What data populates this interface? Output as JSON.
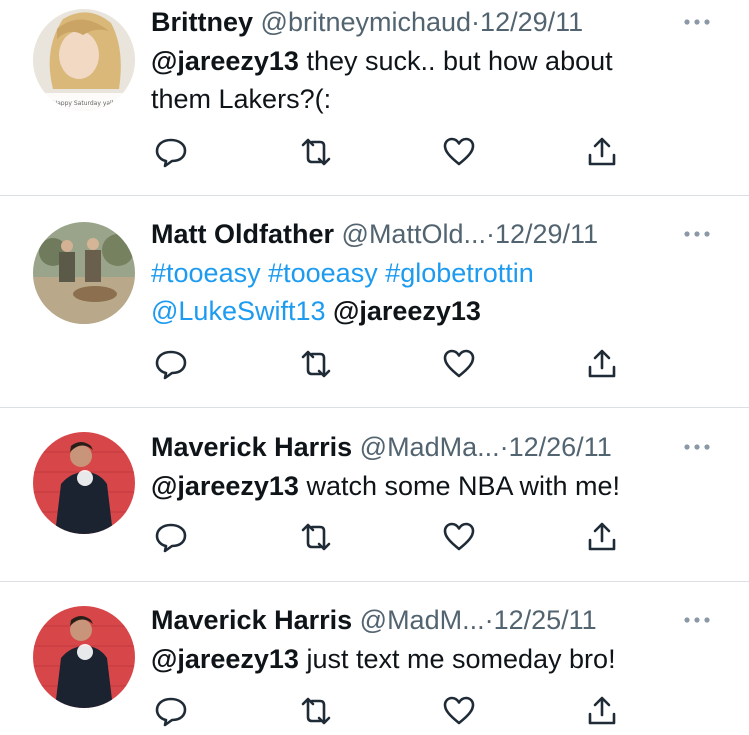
{
  "tweets": [
    {
      "name": "Brittney",
      "handle": "@britneymichaud",
      "sep": "·",
      "date": "12/29/11",
      "body": [
        {
          "type": "mention",
          "text": "@jareezy13"
        },
        {
          "type": "text",
          "text": " they suck.. but how about them Lakers?(:"
        }
      ],
      "avatar_caption": "Happy Saturday yall"
    },
    {
      "name": "Matt Oldfather",
      "handle": "@MattOld...",
      "sep": "·",
      "date": "12/29/11",
      "body": [
        {
          "type": "link",
          "text": "#tooeasy"
        },
        {
          "type": "text",
          "text": " "
        },
        {
          "type": "link",
          "text": "#tooeasy"
        },
        {
          "type": "text",
          "text": " "
        },
        {
          "type": "link",
          "text": "#globetrottin"
        },
        {
          "type": "text",
          "text": " "
        },
        {
          "type": "link",
          "text": "@LukeSwift13"
        },
        {
          "type": "text",
          "text": " "
        },
        {
          "type": "mention",
          "text": "@jareezy13"
        }
      ]
    },
    {
      "name": "Maverick Harris",
      "handle": "@MadMa...",
      "sep": "·",
      "date": "12/26/11",
      "body": [
        {
          "type": "mention",
          "text": "@jareezy13"
        },
        {
          "type": "text",
          "text": " watch some NBA with me!"
        }
      ]
    },
    {
      "name": "Maverick Harris",
      "handle": "@MadM...",
      "sep": "·",
      "date": "12/25/11",
      "body": [
        {
          "type": "mention",
          "text": "@jareezy13"
        },
        {
          "type": "text",
          "text": " just text me someday bro!"
        }
      ]
    }
  ],
  "colors": {
    "text": "#0f1419",
    "secondary": "#536471",
    "link": "#1d9bf0",
    "divider": "#dcdfe3"
  },
  "icons": {
    "more": "more-horizontal-icon",
    "reply": "reply-icon",
    "retweet": "retweet-icon",
    "like": "heart-icon",
    "share": "share-icon"
  }
}
